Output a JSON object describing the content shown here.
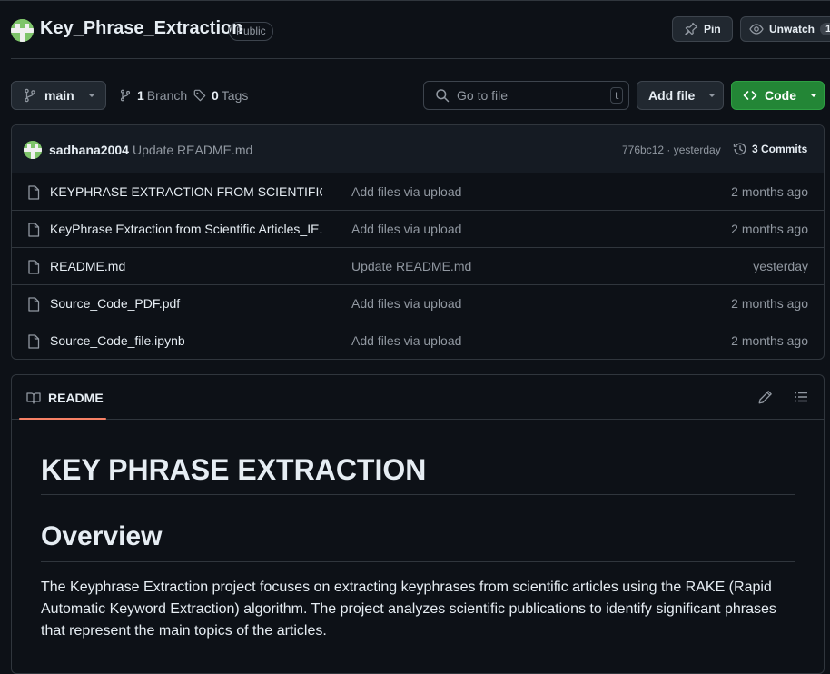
{
  "repo": {
    "name": "Key_Phrase_Extraction",
    "visibility": "Public"
  },
  "header_actions": {
    "pin_label": "Pin",
    "watch_label": "Unwatch",
    "watch_count": "1"
  },
  "toolbar": {
    "branch": "main",
    "branch_count": "1",
    "branch_label": "Branch",
    "tag_count": "0",
    "tag_label": "Tags",
    "search_placeholder": "Go to file",
    "search_shortcut": "t",
    "add_file_label": "Add file",
    "code_label": "Code"
  },
  "latest_commit": {
    "author": "sadhana2004",
    "message": "Update README.md",
    "hash_time": "776bc12 · yesterday",
    "commits_label": "3 Commits"
  },
  "files": [
    {
      "name": "KEYPHRASE EXTRACTION FROM SCIENTIFIC A...",
      "message": "Add files via upload",
      "date": "2 months ago"
    },
    {
      "name": "KeyPhrase Extraction from Scientific Articles_IE...",
      "message": "Add files via upload",
      "date": "2 months ago"
    },
    {
      "name": "README.md",
      "message": "Update README.md",
      "date": "yesterday"
    },
    {
      "name": "Source_Code_PDF.pdf",
      "message": "Add files via upload",
      "date": "2 months ago"
    },
    {
      "name": "Source_Code_file.ipynb",
      "message": "Add files via upload",
      "date": "2 months ago"
    }
  ],
  "readme": {
    "tab_label": "README",
    "title": "KEY PHRASE EXTRACTION",
    "section_heading": "Overview",
    "paragraph": "The Keyphrase Extraction project focuses on extracting keyphrases from scientific articles using the RAKE (Rapid Automatic Keyword Extraction) algorithm. The project analyzes scientific publications to identify significant phrases that represent the main topics of the articles."
  },
  "icons": {
    "avatar": "identicon-avatar",
    "pin": "pin-icon",
    "watch": "eye-icon",
    "branch": "git-branch-icon",
    "tag": "tag-icon",
    "search": "search-icon",
    "code": "code-icon",
    "history": "history-icon",
    "file": "file-icon",
    "book": "book-icon",
    "edit": "pencil-icon",
    "toc": "list-icon"
  },
  "colors": {
    "background": "#0d1117",
    "border": "#30363d",
    "text": "#e6edf3",
    "muted": "#9198a1",
    "code_button": "#238636",
    "tab_underline": "#f78166",
    "avatar": "#7ec46a"
  }
}
